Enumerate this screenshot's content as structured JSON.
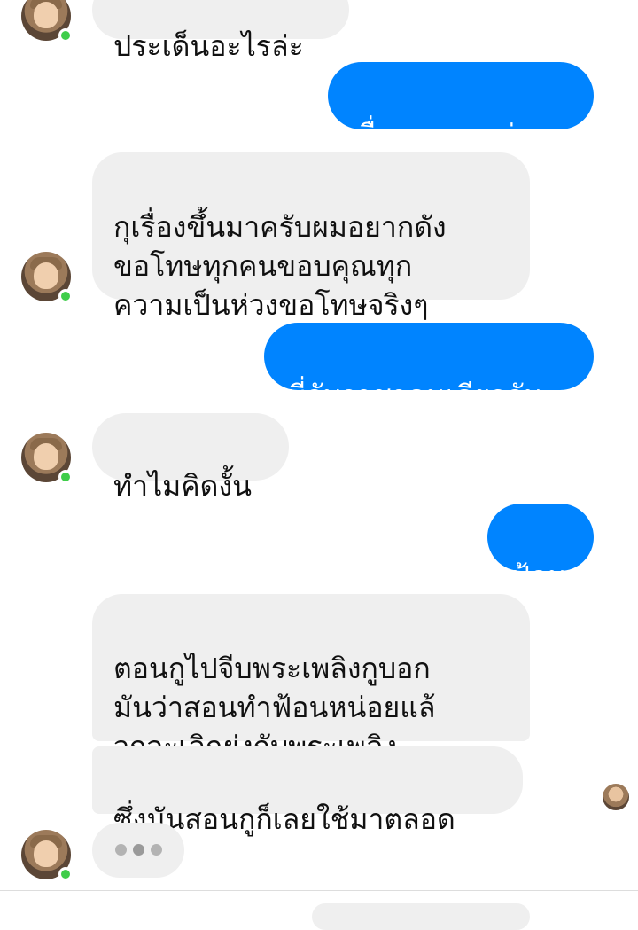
{
  "colors": {
    "incoming_bubble": "#efefef",
    "outgoing_bubble": "#0084ff",
    "online": "#3fcd4a"
  },
  "messages": [
    {
      "from": "them",
      "text": "ประเด็นอะไรล่ะ"
    },
    {
      "from": "me",
      "text": "เรื่องของเราก่อน"
    },
    {
      "from": "them",
      "text": "กุเรื่องขึ้นมาครับผมอยากดัง\nขอโทษทุกคนขอบคุณทุก\nความเป็นห่วงขอโทษจริงๆ"
    },
    {
      "from": "me",
      "text": "พี่กับราชาคนเดียวกัน"
    },
    {
      "from": "them",
      "text": "ทำไมคิดงั้น"
    },
    {
      "from": "me",
      "text": "ฟ้อน"
    },
    {
      "from": "them",
      "text": "ตอนกูไปจีบพระเพลิงกูบอก\nมันว่าสอนทำฟ้อนหน่อยแล้\nวกูจะเลิกยุ่งกับพระเพลิง"
    },
    {
      "from": "them",
      "text": "ซึ่งมันสอนกูก็เลยใช้มาตลอด"
    }
  ],
  "typing_indicator": true,
  "icons": [
    "contact-avatar-icon",
    "online-status-icon",
    "seen-avatar-icon",
    "typing-dots-icon"
  ]
}
